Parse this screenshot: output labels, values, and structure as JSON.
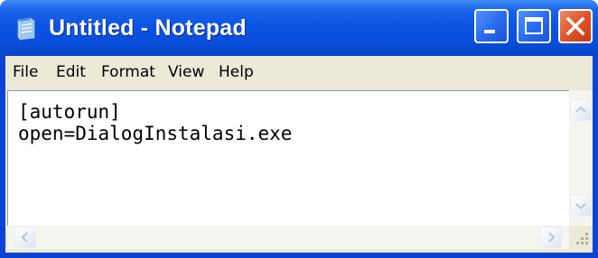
{
  "window": {
    "title": "Untitled - Notepad",
    "icon": "notepad-icon",
    "controls": {
      "minimize_icon": "minimize-icon",
      "maximize_icon": "maximize-icon",
      "close_icon": "close-icon"
    }
  },
  "menu": {
    "file": "File",
    "edit": "Edit",
    "format": "Format",
    "view": "View",
    "help": "Help"
  },
  "editor": {
    "content": "[autorun]\nopen=DialogInstalasi.exe"
  },
  "colors": {
    "titlebar": "#0a54e3",
    "close_button": "#e05428",
    "menu_background": "#ece9d8"
  }
}
